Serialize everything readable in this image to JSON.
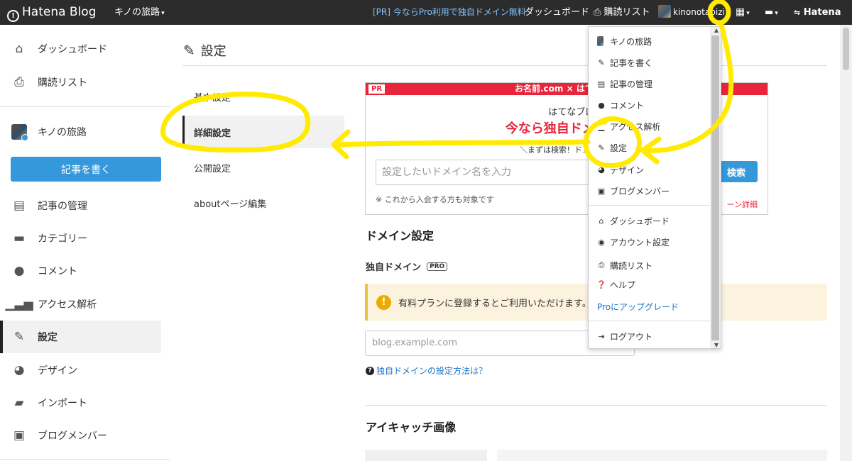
{
  "topbar": {
    "brand": "Hatena Blog",
    "blog_switch": "キノの旅路",
    "pr_link": "[PR] 今ならPro利用で独自ドメイン無料",
    "dashboard": "ダッシュボード",
    "subscriptions": "購読リスト",
    "username": "kinonotabizi",
    "hatena": "Hatena"
  },
  "sidebar": {
    "items": [
      {
        "label": "ダッシュボード",
        "icon": "home-icon"
      },
      {
        "label": "購読リスト",
        "icon": "subscription-icon"
      },
      {
        "label": "キノの旅路",
        "icon": "blog-avatar"
      },
      {
        "label": "記事を書く"
      },
      {
        "label": "記事の管理",
        "icon": "document-icon"
      },
      {
        "label": "カテゴリー",
        "icon": "folder-icon"
      },
      {
        "label": "コメント",
        "icon": "comment-icon"
      },
      {
        "label": "アクセス解析",
        "icon": "bar-chart-icon"
      },
      {
        "label": "設定",
        "icon": "wrench-icon"
      },
      {
        "label": "デザイン",
        "icon": "palette-icon"
      },
      {
        "label": "インポート",
        "icon": "truck-icon"
      },
      {
        "label": "ブログメンバー",
        "icon": "member-icon"
      }
    ]
  },
  "page": {
    "title": "設定",
    "subnav": [
      "基本設定",
      "詳細設定",
      "公開設定",
      "aboutページ編集"
    ]
  },
  "ad": {
    "pr": "PR",
    "head": "お名前.com × はて",
    "line1": "はてなブログProご",
    "line2": "今なら独自ドメイン1年",
    "line3": "＼まずは検索！ドメイン名",
    "placeholder": "設定したいドメイン名を入力",
    "button": "検索",
    "note": "※ これから入会する方も対象です",
    "link": "ーン詳細"
  },
  "domain": {
    "heading": "ドメイン設定",
    "label": "独自ドメイン",
    "pro_badge": "PRO",
    "warning": "有料プランに登録するとご利用いただけます。",
    "input_placeholder": "blog.example.com",
    "help": "独自ドメインの設定方法は？"
  },
  "eyecatch": {
    "heading": "アイキャッチ画像"
  },
  "dropdown": {
    "items": [
      "キノの旅路",
      "記事を書く",
      "記事の管理",
      "コメント",
      "アクセス解析",
      "設定",
      "デザイン",
      "ブログメンバー",
      "ダッシュボード",
      "アカウント設定",
      "購読リスト",
      "ヘルプ",
      "Proにアップグレード",
      "ログアウト"
    ]
  },
  "colors": {
    "accent": "#3498db",
    "annotation": "#ffea00",
    "ad_red": "#e8253a"
  }
}
